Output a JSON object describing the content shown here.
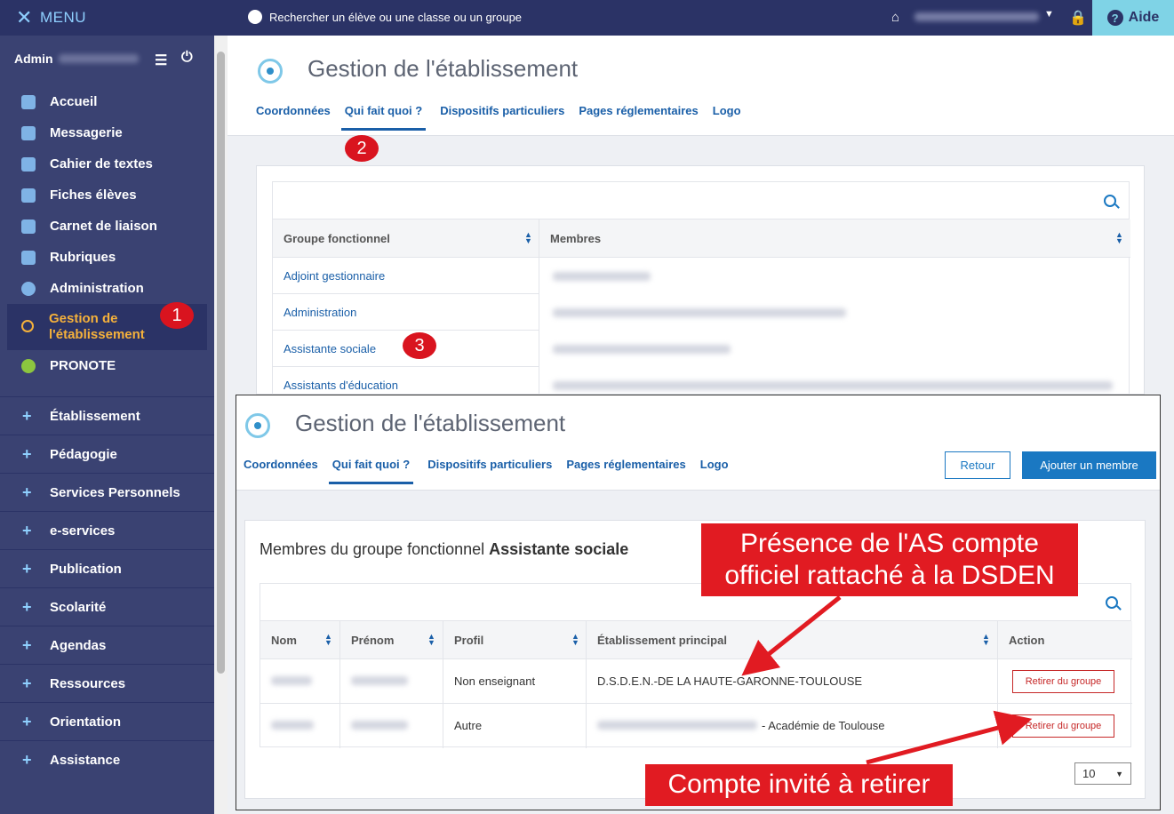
{
  "sidebar": {
    "menu_label": "MENU",
    "admin_label": "Admin",
    "items": [
      {
        "label": "Accueil",
        "icon": "grid-icon",
        "color": "#7fb3e6"
      },
      {
        "label": "Messagerie",
        "icon": "mail-icon",
        "color": "#7fb3e6"
      },
      {
        "label": "Cahier de textes",
        "icon": "notebook-icon",
        "color": "#7fb3e6"
      },
      {
        "label": "Fiches élèves",
        "icon": "users-icon",
        "color": "#7fb3e6"
      },
      {
        "label": "Carnet de liaison",
        "icon": "link-icon",
        "color": "#7fb3e6"
      },
      {
        "label": "Rubriques",
        "icon": "chat-icon",
        "color": "#7fb3e6"
      },
      {
        "label": "Administration",
        "icon": "gear-icon",
        "color": "#7fb3e6"
      }
    ],
    "active_item": "Gestion de l'établissement",
    "pronote": "PRONOTE",
    "sections": [
      "Établissement",
      "Pédagogie",
      "Services Personnels",
      "e-services",
      "Publication",
      "Scolarité",
      "Agendas",
      "Ressources",
      "Orientation",
      "Assistance"
    ]
  },
  "topbar": {
    "search_placeholder": "Rechercher un élève ou une classe ou un groupe",
    "help": "Aide"
  },
  "page": {
    "title": "Gestion de l'établissement",
    "tabs": [
      "Coordonnées",
      "Qui fait quoi ?",
      "Dispositifs particuliers",
      "Pages réglementaires",
      "Logo"
    ],
    "table_headers": [
      "Groupe fonctionnel",
      "Membres"
    ],
    "groups": [
      "Adjoint gestionnaire",
      "Administration",
      "Assistante sociale",
      "Assistants d'éducation"
    ]
  },
  "overlay": {
    "title": "Gestion de l'établissement",
    "tabs": [
      "Coordonnées",
      "Qui fait quoi ?",
      "Dispositifs particuliers",
      "Pages réglementaires",
      "Logo"
    ],
    "back_button": "Retour",
    "add_button": "Ajouter un membre",
    "heading_prefix": "Membres du groupe fonctionnel ",
    "heading_group": "Assistante sociale",
    "headers": [
      "Nom",
      "Prénom",
      "Profil",
      "Établissement principal",
      "Action"
    ],
    "rows": [
      {
        "profil": "Non enseignant",
        "etab": "D.S.D.E.N.-DE LA HAUTE-GARONNE-TOULOUSE",
        "action": "Retirer du groupe"
      },
      {
        "profil": "Autre",
        "etab": "- Académie de Toulouse",
        "action": "Retirer du groupe"
      }
    ],
    "page_size": "10"
  },
  "annotations": {
    "badge1": "1",
    "badge2": "2",
    "badge3": "3",
    "callout_top": "Présence de l'AS compte officiel rattaché à la DSDEN",
    "callout_bottom": "Compte invité à retirer"
  }
}
